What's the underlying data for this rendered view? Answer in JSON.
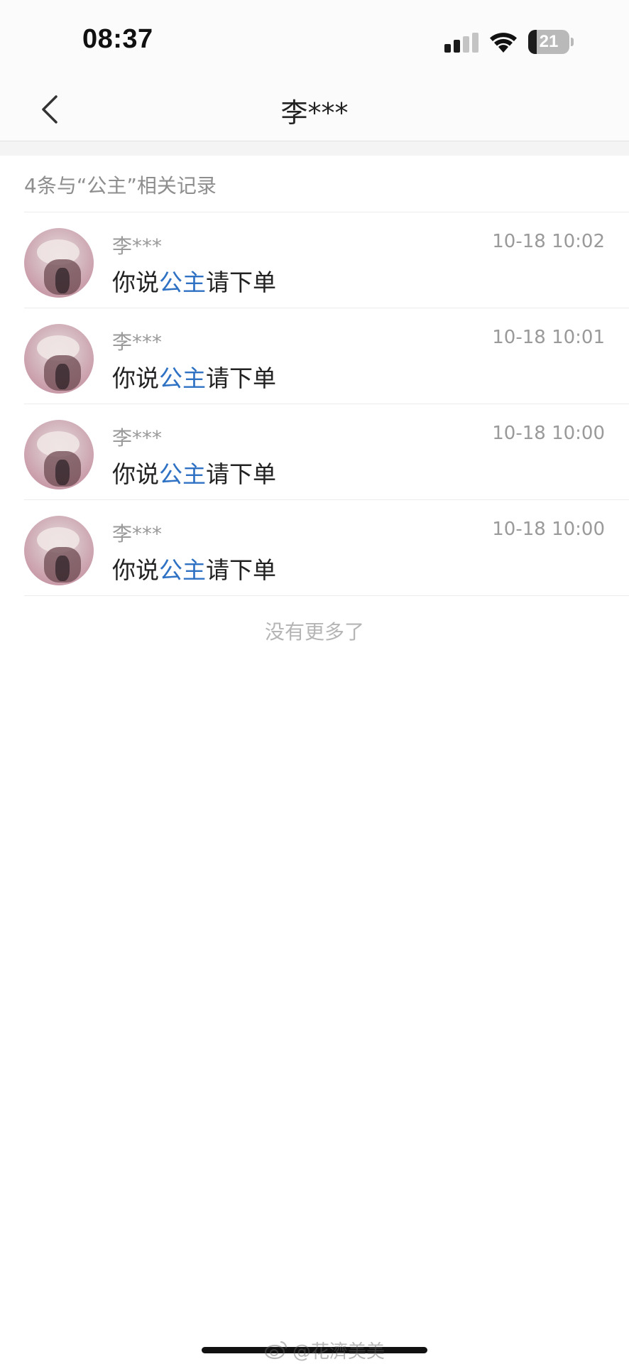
{
  "status_bar": {
    "time": "08:37",
    "battery_level": "21",
    "battery_fraction": 0.21,
    "icons": [
      "signal-icon",
      "wifi-icon",
      "battery-icon"
    ]
  },
  "nav": {
    "title": "李***",
    "back_icon": "chevron-left-icon"
  },
  "search": {
    "summary": "4条与“公主”相关记录",
    "keyword": "公主"
  },
  "results": [
    {
      "name": "李***",
      "time": "10-18 10:02",
      "message_before": "你说",
      "message_keyword": "公主",
      "message_after": "请下单"
    },
    {
      "name": "李***",
      "time": "10-18 10:01",
      "message_before": "你说",
      "message_keyword": "公主",
      "message_after": "请下单"
    },
    {
      "name": "李***",
      "time": "10-18 10:00",
      "message_before": "你说",
      "message_keyword": "公主",
      "message_after": "请下单"
    },
    {
      "name": "李***",
      "time": "10-18 10:00",
      "message_before": "你说",
      "message_keyword": "公主",
      "message_after": "请下单"
    }
  ],
  "footer": {
    "no_more": "没有更多了"
  },
  "watermark": {
    "text": "@花濟美美",
    "icon": "weibo-icon"
  },
  "colors": {
    "keyword": "#2f72c4",
    "secondary_text": "#9a9a9a",
    "background": "#ffffff"
  }
}
